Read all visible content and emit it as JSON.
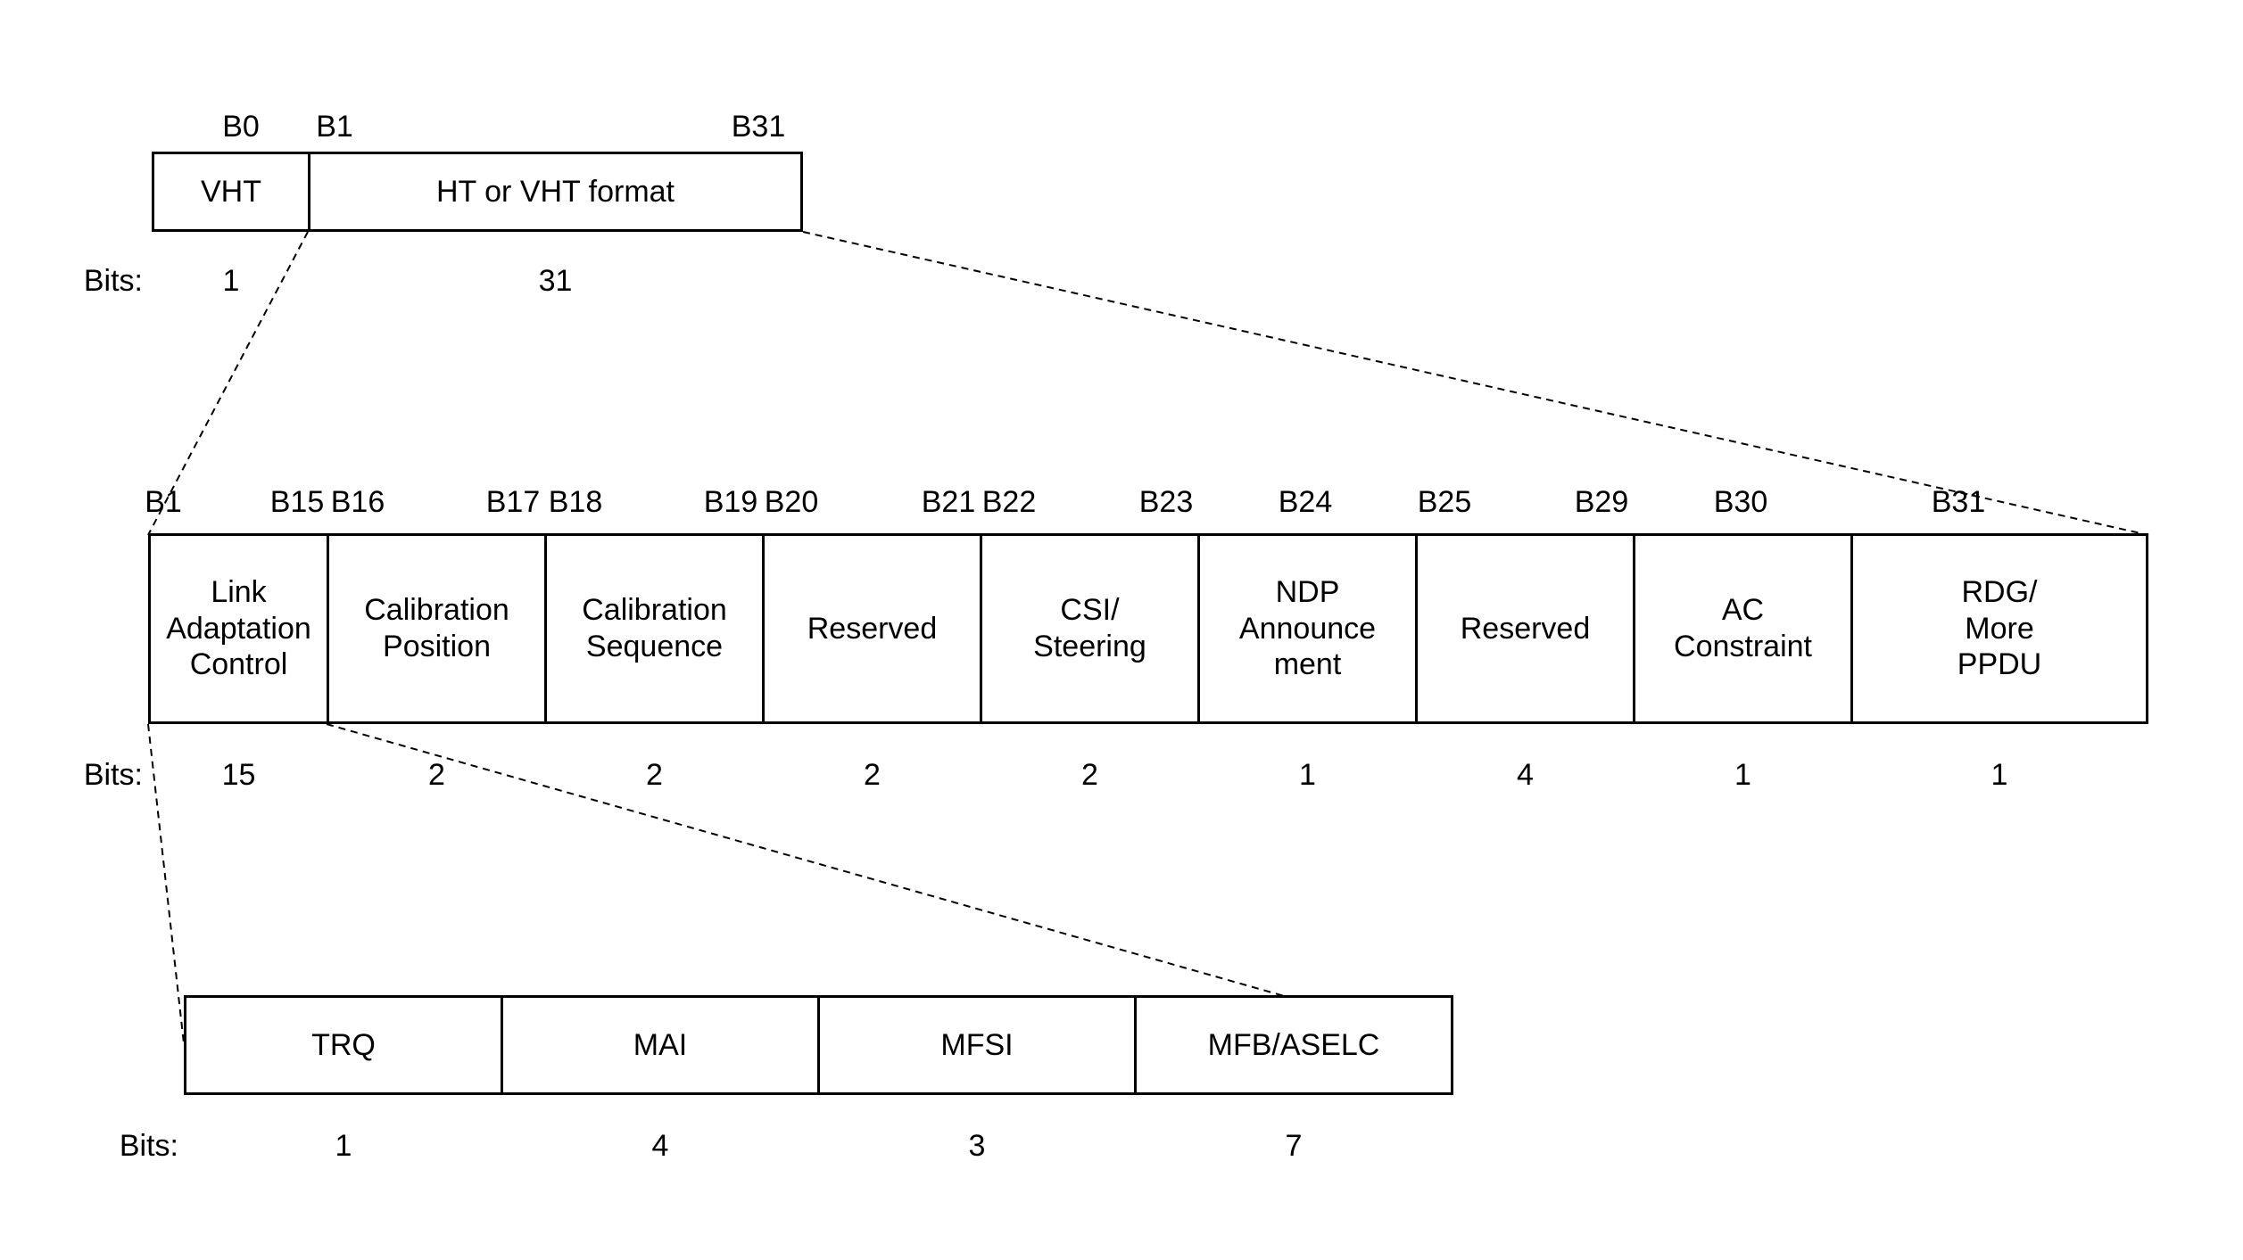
{
  "labels": {
    "bits_prefix": "Bits:"
  },
  "row1": {
    "bit_labels": {
      "b0": "B0",
      "b1": "B1",
      "b31": "B31"
    },
    "fields": [
      {
        "name": "VHT",
        "bits": "1"
      },
      {
        "name": "HT or VHT format",
        "bits": "31"
      }
    ]
  },
  "row2": {
    "bit_labels": {
      "b1": "B1",
      "b15": "B15",
      "b16": "B16",
      "b17": "B17",
      "b18": "B18",
      "b19": "B19",
      "b20": "B20",
      "b21": "B21",
      "b22": "B22",
      "b23": "B23",
      "b24": "B24",
      "b25": "B25",
      "b29": "B29",
      "b30": "B30",
      "b31": "B31"
    },
    "fields": [
      {
        "name": "Link\nAdaptation\nControl",
        "bits": "15"
      },
      {
        "name": "Calibration\nPosition",
        "bits": "2"
      },
      {
        "name": "Calibration\nSequence",
        "bits": "2"
      },
      {
        "name": "Reserved",
        "bits": "2"
      },
      {
        "name": "CSI/\nSteering",
        "bits": "2"
      },
      {
        "name": "NDP\nAnnounce\nment",
        "bits": "1"
      },
      {
        "name": "Reserved",
        "bits": "4"
      },
      {
        "name": "AC\nConstraint",
        "bits": "1"
      },
      {
        "name": "RDG/\nMore\nPPDU",
        "bits": "1"
      }
    ]
  },
  "row3": {
    "fields": [
      {
        "name": "TRQ",
        "bits": "1"
      },
      {
        "name": "MAI",
        "bits": "4"
      },
      {
        "name": "MFSI",
        "bits": "3"
      },
      {
        "name": "MFB/ASELC",
        "bits": "7"
      }
    ]
  }
}
